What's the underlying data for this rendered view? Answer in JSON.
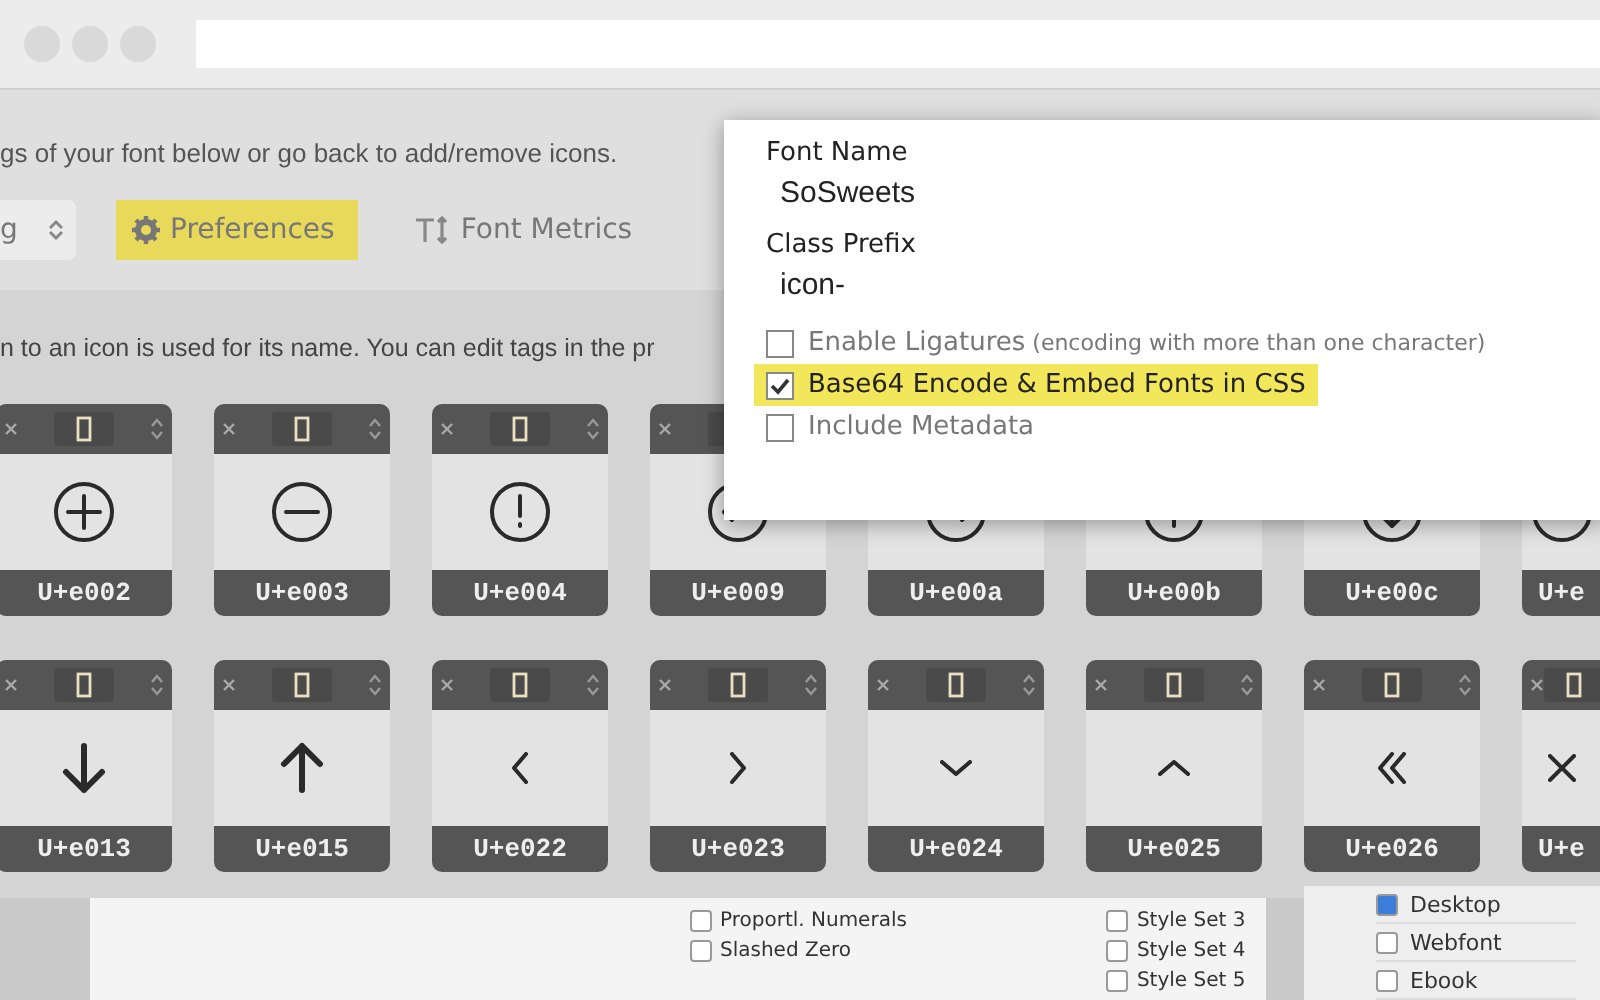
{
  "intro_text": "gs of your font below or go back to add/remove icons.",
  "toolbar": {
    "select_value": "g",
    "items": [
      {
        "label": "Preferences",
        "highlighted": true
      },
      {
        "label": "Font Metrics",
        "highlighted": false
      }
    ]
  },
  "hint_text": "n to an icon is used for its name. You can edit tags in the pr",
  "glyph_rows": [
    [
      {
        "code": "U+e002"
      },
      {
        "code": "U+e003"
      },
      {
        "code": "U+e004"
      },
      {
        "code": "U+e009"
      },
      {
        "code": "U+e00a"
      },
      {
        "code": "U+e00b"
      },
      {
        "code": "U+e00c"
      },
      {
        "code": "U+e"
      }
    ],
    [
      {
        "code": "U+e013"
      },
      {
        "code": "U+e015"
      },
      {
        "code": "U+e022"
      },
      {
        "code": "U+e023"
      },
      {
        "code": "U+e024"
      },
      {
        "code": "U+e025"
      },
      {
        "code": "U+e026"
      },
      {
        "code": "U+e"
      }
    ]
  ],
  "preferences": {
    "font_name_label": "Font Name",
    "font_name": "SoSweets",
    "class_prefix_label": "Class Prefix",
    "class_prefix": "icon-",
    "options": [
      {
        "label": "Enable Ligatures",
        "note": "(encoding with more than one character)",
        "checked": false,
        "highlighted": false
      },
      {
        "label": "Base64 Encode & Embed Fonts in CSS",
        "checked": true,
        "highlighted": true
      },
      {
        "label": "Include Metadata",
        "checked": false,
        "highlighted": false
      }
    ]
  },
  "document": {
    "columns": [
      [
        {
          "label": "Proportl. Numerals",
          "checked": false
        },
        {
          "label": "Slashed Zero",
          "checked": false
        }
      ],
      [
        {
          "label": "Style Set 3",
          "checked": false
        },
        {
          "label": "Style Set 4",
          "checked": false
        },
        {
          "label": "Style Set 5",
          "checked": false
        }
      ]
    ]
  },
  "formats": [
    {
      "label": "Desktop",
      "checked": true
    },
    {
      "label": "Webfont",
      "checked": false
    },
    {
      "label": "Ebook",
      "checked": false
    }
  ]
}
